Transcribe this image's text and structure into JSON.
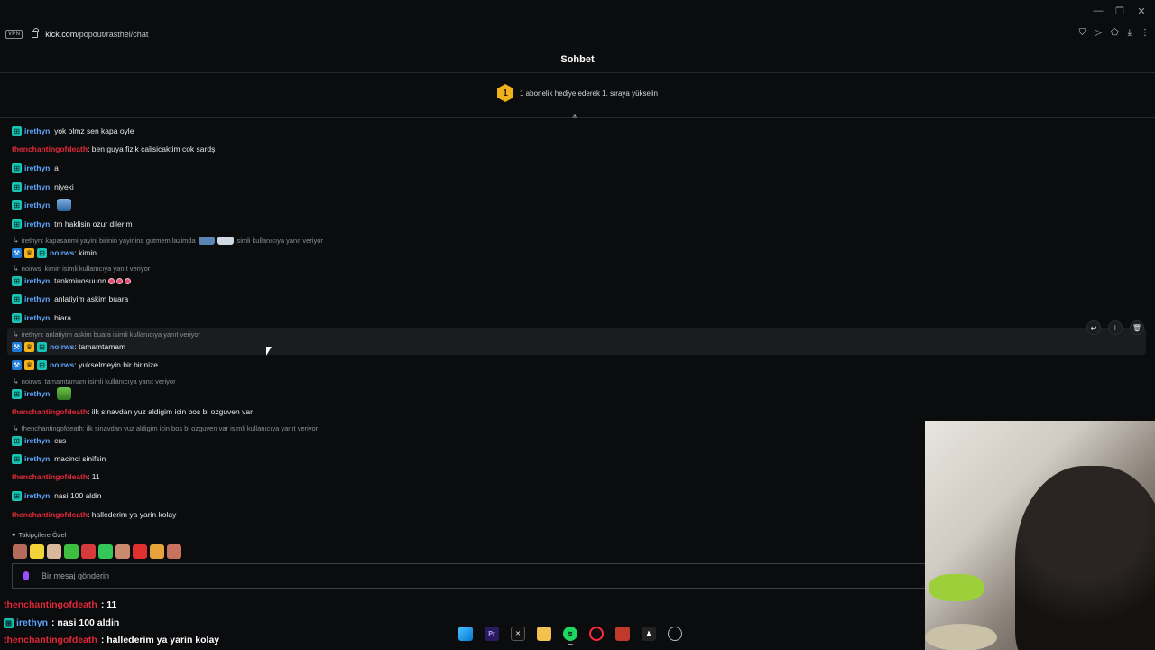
{
  "browser": {
    "vpn_label": "VPN",
    "url_domain": "kick.com",
    "url_path": "/popout/rasthel/chat"
  },
  "chat": {
    "title": "Sohbet",
    "banner": {
      "rank": "1",
      "text": "1 abonelik hediye ederek 1. sıraya yükselin"
    },
    "messages": [
      {
        "user": "irethyn",
        "color": "blue",
        "badges": [
          "sub"
        ],
        "text": "yok olmz sen kapa oyle"
      },
      {
        "user": "thenchantingofdeath",
        "color": "red",
        "badges": [],
        "text": "ben guya fizik calisicaktim cok sardş"
      },
      {
        "user": "irethyn",
        "color": "blue",
        "badges": [
          "sub"
        ],
        "text": "a"
      },
      {
        "user": "irethyn",
        "color": "blue",
        "badges": [
          "sub"
        ],
        "text": "niyeki"
      },
      {
        "user": "irethyn",
        "color": "blue",
        "badges": [
          "sub"
        ],
        "text": ""
      },
      {
        "user": "irethyn",
        "color": "blue",
        "badges": [
          "sub"
        ],
        "text": "tm haklisin ozur dilerim"
      },
      {
        "reply": "irethyn: kapasanmi yayini birinin yayinina gutmem lazimda",
        "reply_suffix": "isimli kullanıcıya yanıt veriyor"
      },
      {
        "user": "noirws",
        "color": "blue",
        "badges": [
          "pick",
          "crown",
          "sub"
        ],
        "text": "kimin"
      },
      {
        "reply": "noirws: kimin isimli kullanıcıya yanıt veriyor"
      },
      {
        "user": "irethyn",
        "color": "blue",
        "badges": [
          "sub"
        ],
        "text": "tankmiuosuunn"
      },
      {
        "user": "irethyn",
        "color": "blue",
        "badges": [
          "sub"
        ],
        "text": "anlatiyim askim buara"
      },
      {
        "user": "irethyn",
        "color": "blue",
        "badges": [
          "sub"
        ],
        "text": "biara"
      },
      {
        "reply": "irethyn: anlatiyim askim buara isimli kullanıcıya yanıt veriyor"
      },
      {
        "user": "noirws",
        "color": "blue",
        "badges": [
          "pick",
          "crown",
          "sub"
        ],
        "text": "tamamtamam"
      },
      {
        "user": "noirws",
        "color": "blue",
        "badges": [
          "pick",
          "crown",
          "sub"
        ],
        "text": "yukselmeyin bir birinize"
      },
      {
        "reply": "noirws: tamamtamam isimli kullanıcıya yanıt veriyor"
      },
      {
        "user": "irethyn",
        "color": "blue",
        "badges": [
          "sub"
        ],
        "text": ""
      },
      {
        "user": "thenchantingofdeath",
        "color": "red",
        "badges": [],
        "text": "ilk sinavdan yuz aldigim icin bos bi ozguven var"
      },
      {
        "reply": "thenchantingofdeath: ilk sinavdan yuz aldigim icin bos bi ozguven var isimli kullanıcıya yanıt veriyor"
      },
      {
        "user": "irethyn",
        "color": "blue",
        "badges": [
          "sub"
        ],
        "text": "cus"
      },
      {
        "user": "irethyn",
        "color": "blue",
        "badges": [
          "sub"
        ],
        "text": "macinci sinifsin"
      },
      {
        "user": "thenchantingofdeath",
        "color": "red",
        "badges": [],
        "text": "11"
      },
      {
        "user": "irethyn",
        "color": "blue",
        "badges": [
          "sub"
        ],
        "text": "nasi 100 aldin"
      },
      {
        "user": "thenchantingofdeath",
        "color": "red",
        "badges": [],
        "text": "hallederim ya yarin kolay"
      }
    ],
    "follower_label": "Takipçilere Özel",
    "input_placeholder": "Bir mesaj gönderin"
  },
  "overlay": [
    {
      "user": "thenchantingofdeath",
      "color": "red",
      "text": ": 11"
    },
    {
      "user": "irethyn",
      "color": "blue",
      "text": ": nasi 100 aldin"
    },
    {
      "user": "thenchantingofdeath",
      "color": "red",
      "text": ": hallederim ya yarin kolay"
    }
  ],
  "icons": {
    "badge_sub": "sub-badge-icon",
    "badge_crown": "crown-badge-icon",
    "badge_pick": "pickaxe-badge-icon"
  },
  "colors": {
    "blue_user": "#5ea7ff",
    "red_user": "#e02b3c",
    "accent": "#f0b21a",
    "sub_badge": "#18c5b5"
  }
}
